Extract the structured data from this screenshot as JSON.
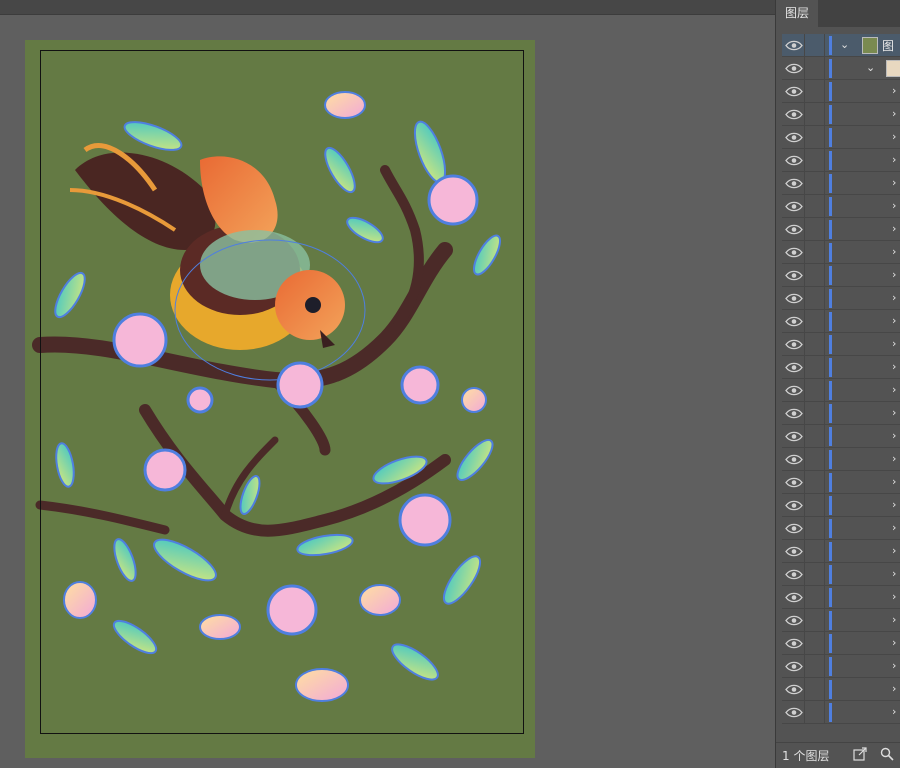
{
  "panel": {
    "tab_label": "图层",
    "top_layer_name": "图",
    "footer_count": "1 个图层",
    "row_count": 30
  },
  "colors": {
    "artboard": "#647a44",
    "selection": "#4f7fe0",
    "panel_bg": "#535353",
    "canvas_bg": "#5f5f5f"
  },
  "icons": [
    "eye-icon",
    "chevron-down-icon",
    "chevron-right-icon",
    "export-icon",
    "search-icon"
  ]
}
